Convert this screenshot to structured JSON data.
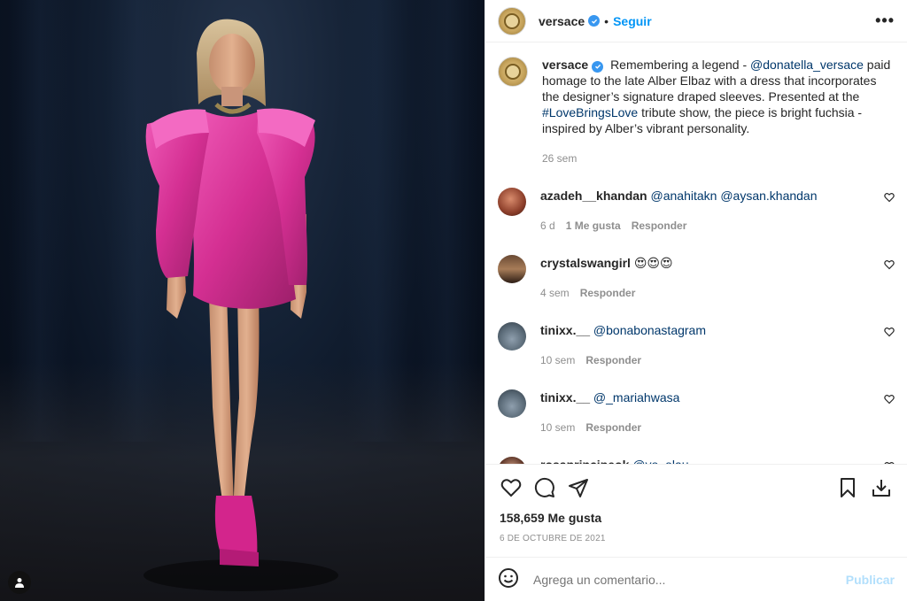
{
  "post": {
    "author": "versace",
    "follow_label": "Seguir",
    "more_label": "•••",
    "separator": "•",
    "caption_parts": [
      "Remembering a legend - ",
      "@donatella_versace",
      " paid homage to the late Alber Elbaz with a dress that incorporates the designer’s signature draped sleeves. Presented at the ",
      "#LoveBringsLove",
      " tribute show, the piece is bright fuchsia - inspired by Alber’s vibrant personality."
    ],
    "caption_time": "26 sem",
    "likes": "158,659 Me gusta",
    "date": "6 DE OCTUBRE DE 2021"
  },
  "comments": [
    {
      "user": "azadeh__khandan",
      "text": "@anahitakn @aysan.khandan",
      "time": "6 d",
      "likes": "1 Me gusta",
      "reply": "Responder"
    },
    {
      "user": "crystalswangirl",
      "text": "😍😍😍",
      "time": "4 sem",
      "likes": "",
      "reply": "Responder"
    },
    {
      "user": "tinixx.__",
      "text": "@bonabonastagram",
      "time": "10 sem",
      "likes": "",
      "reply": "Responder"
    },
    {
      "user": "tinixx.__",
      "text": "@_mariahwasa",
      "time": "10 sem",
      "likes": "",
      "reply": "Responder"
    },
    {
      "user": "rosaprincipeok",
      "text": "@yo_olau",
      "time": "",
      "likes": "",
      "reply": ""
    }
  ],
  "add_comment": {
    "placeholder": "Agrega un comentario...",
    "publish_label": "Publicar"
  },
  "colors": {
    "link": "#00376b",
    "follow": "#0095f6",
    "dress": "#e0379f",
    "muted": "#8e8e8e"
  },
  "icons": {
    "like": "heart-icon",
    "comment": "comment-icon",
    "share": "paper-plane-icon",
    "save": "bookmark-icon",
    "download": "download-icon",
    "emoji": "emoji-icon",
    "tag": "user-tag-icon",
    "verified": "verified-badge-icon"
  }
}
